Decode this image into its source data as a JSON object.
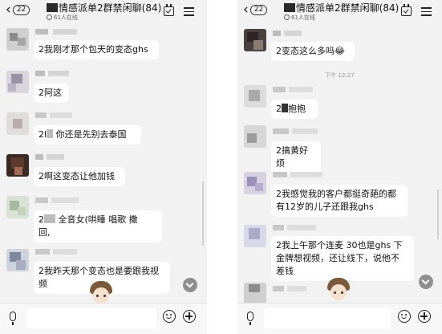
{
  "left_screen": {
    "header": {
      "back_count": "22",
      "title_prefix": "",
      "title_text": "情感派单2群禁闲聊(84)",
      "online": "61人在线"
    },
    "messages": [
      {
        "text": "2我刚才那个包天的变态ghs"
      },
      {
        "text": "2阿这"
      },
      {
        "prefix": "2l",
        "text": "你还是先别去泰国"
      },
      {
        "text": "2啊这变态让他加钱"
      },
      {
        "prefix": "2",
        "text": "全音女(哄睡 唱歌 撒\n回,"
      },
      {
        "text": "2我昨天那个变态也是要跟我视\n频"
      }
    ]
  },
  "right_screen": {
    "header": {
      "back_count": "22",
      "title_text": "情感派单2群禁闲聊(84)",
      "online": "61人在线"
    },
    "messages": [
      {
        "text": "2变态这么多吗😂"
      },
      {
        "prefix": "2",
        "text": "抱抱"
      },
      {
        "text": "2搞黄好烦"
      },
      {
        "text": "2我感觉我的客户都挺奇葩的都\n有12岁的儿子还跟我ghs"
      },
      {
        "text": "2我上午那个连麦 30也是ghs 下\n金牌想视频，还让线下，说他不\n差钱"
      }
    ],
    "timestamp": "下午 12:27"
  },
  "icons": {
    "back": "chevron-left-icon",
    "calendar": "calendar-check-icon",
    "menu": "menu-icon",
    "voice": "microphone-icon",
    "emoji": "emoji-icon",
    "add": "plus-icon",
    "scroll_down": "chevron-down-icon"
  },
  "colors": {
    "background": "#f2f2f2",
    "bubble": "#ffffff",
    "text": "#111111",
    "fab": "#8f8f8f"
  }
}
